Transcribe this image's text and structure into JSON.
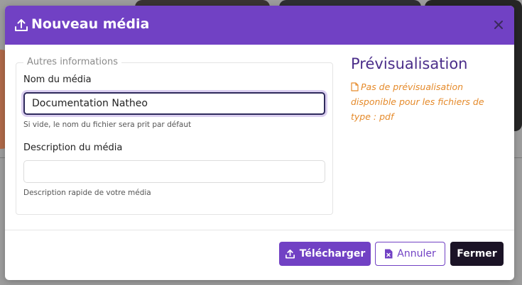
{
  "modal": {
    "title": "Nouveau média",
    "fieldset_legend": "Autres informations",
    "name_label": "Nom du média",
    "name_value": "Documentation Natheo",
    "name_help": "Si vide, le nom du fichier sera prit par défaut",
    "description_label": "Description du média",
    "description_value": "",
    "description_help": "Description rapide de votre média",
    "preview_title": "Prévisualisation",
    "preview_message": "Pas de prévisualisation disponible pour les fichiers de type : pdf",
    "buttons": {
      "upload": "Télécharger",
      "cancel": "Annuler",
      "close": "Fermer"
    }
  },
  "colors": {
    "accent": "#7141c4",
    "preview_title": "#4b2e8a",
    "warning": "#e58a2a",
    "dark_button": "#1b1326"
  },
  "icons": [
    "upload-icon",
    "close-icon",
    "file-icon",
    "file-cancel-icon"
  ]
}
